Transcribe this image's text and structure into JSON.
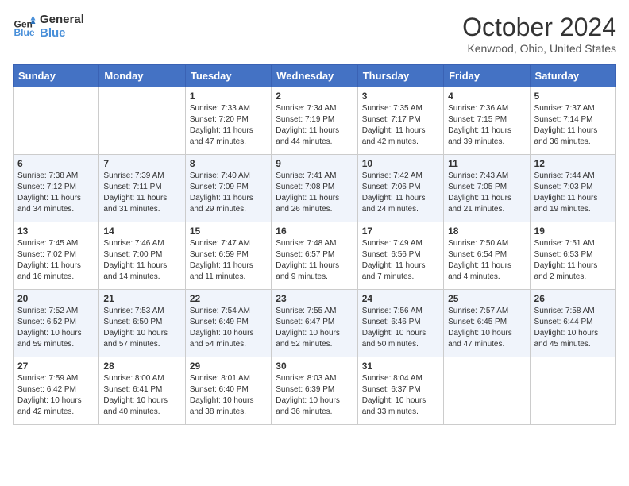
{
  "header": {
    "logo_line1": "General",
    "logo_line2": "Blue",
    "month": "October 2024",
    "location": "Kenwood, Ohio, United States"
  },
  "days_of_week": [
    "Sunday",
    "Monday",
    "Tuesday",
    "Wednesday",
    "Thursday",
    "Friday",
    "Saturday"
  ],
  "weeks": [
    [
      {
        "day": "",
        "sunrise": "",
        "sunset": "",
        "daylight": ""
      },
      {
        "day": "",
        "sunrise": "",
        "sunset": "",
        "daylight": ""
      },
      {
        "day": "1",
        "sunrise": "Sunrise: 7:33 AM",
        "sunset": "Sunset: 7:20 PM",
        "daylight": "Daylight: 11 hours and 47 minutes."
      },
      {
        "day": "2",
        "sunrise": "Sunrise: 7:34 AM",
        "sunset": "Sunset: 7:19 PM",
        "daylight": "Daylight: 11 hours and 44 minutes."
      },
      {
        "day": "3",
        "sunrise": "Sunrise: 7:35 AM",
        "sunset": "Sunset: 7:17 PM",
        "daylight": "Daylight: 11 hours and 42 minutes."
      },
      {
        "day": "4",
        "sunrise": "Sunrise: 7:36 AM",
        "sunset": "Sunset: 7:15 PM",
        "daylight": "Daylight: 11 hours and 39 minutes."
      },
      {
        "day": "5",
        "sunrise": "Sunrise: 7:37 AM",
        "sunset": "Sunset: 7:14 PM",
        "daylight": "Daylight: 11 hours and 36 minutes."
      }
    ],
    [
      {
        "day": "6",
        "sunrise": "Sunrise: 7:38 AM",
        "sunset": "Sunset: 7:12 PM",
        "daylight": "Daylight: 11 hours and 34 minutes."
      },
      {
        "day": "7",
        "sunrise": "Sunrise: 7:39 AM",
        "sunset": "Sunset: 7:11 PM",
        "daylight": "Daylight: 11 hours and 31 minutes."
      },
      {
        "day": "8",
        "sunrise": "Sunrise: 7:40 AM",
        "sunset": "Sunset: 7:09 PM",
        "daylight": "Daylight: 11 hours and 29 minutes."
      },
      {
        "day": "9",
        "sunrise": "Sunrise: 7:41 AM",
        "sunset": "Sunset: 7:08 PM",
        "daylight": "Daylight: 11 hours and 26 minutes."
      },
      {
        "day": "10",
        "sunrise": "Sunrise: 7:42 AM",
        "sunset": "Sunset: 7:06 PM",
        "daylight": "Daylight: 11 hours and 24 minutes."
      },
      {
        "day": "11",
        "sunrise": "Sunrise: 7:43 AM",
        "sunset": "Sunset: 7:05 PM",
        "daylight": "Daylight: 11 hours and 21 minutes."
      },
      {
        "day": "12",
        "sunrise": "Sunrise: 7:44 AM",
        "sunset": "Sunset: 7:03 PM",
        "daylight": "Daylight: 11 hours and 19 minutes."
      }
    ],
    [
      {
        "day": "13",
        "sunrise": "Sunrise: 7:45 AM",
        "sunset": "Sunset: 7:02 PM",
        "daylight": "Daylight: 11 hours and 16 minutes."
      },
      {
        "day": "14",
        "sunrise": "Sunrise: 7:46 AM",
        "sunset": "Sunset: 7:00 PM",
        "daylight": "Daylight: 11 hours and 14 minutes."
      },
      {
        "day": "15",
        "sunrise": "Sunrise: 7:47 AM",
        "sunset": "Sunset: 6:59 PM",
        "daylight": "Daylight: 11 hours and 11 minutes."
      },
      {
        "day": "16",
        "sunrise": "Sunrise: 7:48 AM",
        "sunset": "Sunset: 6:57 PM",
        "daylight": "Daylight: 11 hours and 9 minutes."
      },
      {
        "day": "17",
        "sunrise": "Sunrise: 7:49 AM",
        "sunset": "Sunset: 6:56 PM",
        "daylight": "Daylight: 11 hours and 7 minutes."
      },
      {
        "day": "18",
        "sunrise": "Sunrise: 7:50 AM",
        "sunset": "Sunset: 6:54 PM",
        "daylight": "Daylight: 11 hours and 4 minutes."
      },
      {
        "day": "19",
        "sunrise": "Sunrise: 7:51 AM",
        "sunset": "Sunset: 6:53 PM",
        "daylight": "Daylight: 11 hours and 2 minutes."
      }
    ],
    [
      {
        "day": "20",
        "sunrise": "Sunrise: 7:52 AM",
        "sunset": "Sunset: 6:52 PM",
        "daylight": "Daylight: 10 hours and 59 minutes."
      },
      {
        "day": "21",
        "sunrise": "Sunrise: 7:53 AM",
        "sunset": "Sunset: 6:50 PM",
        "daylight": "Daylight: 10 hours and 57 minutes."
      },
      {
        "day": "22",
        "sunrise": "Sunrise: 7:54 AM",
        "sunset": "Sunset: 6:49 PM",
        "daylight": "Daylight: 10 hours and 54 minutes."
      },
      {
        "day": "23",
        "sunrise": "Sunrise: 7:55 AM",
        "sunset": "Sunset: 6:47 PM",
        "daylight": "Daylight: 10 hours and 52 minutes."
      },
      {
        "day": "24",
        "sunrise": "Sunrise: 7:56 AM",
        "sunset": "Sunset: 6:46 PM",
        "daylight": "Daylight: 10 hours and 50 minutes."
      },
      {
        "day": "25",
        "sunrise": "Sunrise: 7:57 AM",
        "sunset": "Sunset: 6:45 PM",
        "daylight": "Daylight: 10 hours and 47 minutes."
      },
      {
        "day": "26",
        "sunrise": "Sunrise: 7:58 AM",
        "sunset": "Sunset: 6:44 PM",
        "daylight": "Daylight: 10 hours and 45 minutes."
      }
    ],
    [
      {
        "day": "27",
        "sunrise": "Sunrise: 7:59 AM",
        "sunset": "Sunset: 6:42 PM",
        "daylight": "Daylight: 10 hours and 42 minutes."
      },
      {
        "day": "28",
        "sunrise": "Sunrise: 8:00 AM",
        "sunset": "Sunset: 6:41 PM",
        "daylight": "Daylight: 10 hours and 40 minutes."
      },
      {
        "day": "29",
        "sunrise": "Sunrise: 8:01 AM",
        "sunset": "Sunset: 6:40 PM",
        "daylight": "Daylight: 10 hours and 38 minutes."
      },
      {
        "day": "30",
        "sunrise": "Sunrise: 8:03 AM",
        "sunset": "Sunset: 6:39 PM",
        "daylight": "Daylight: 10 hours and 36 minutes."
      },
      {
        "day": "31",
        "sunrise": "Sunrise: 8:04 AM",
        "sunset": "Sunset: 6:37 PM",
        "daylight": "Daylight: 10 hours and 33 minutes."
      },
      {
        "day": "",
        "sunrise": "",
        "sunset": "",
        "daylight": ""
      },
      {
        "day": "",
        "sunrise": "",
        "sunset": "",
        "daylight": ""
      }
    ]
  ]
}
